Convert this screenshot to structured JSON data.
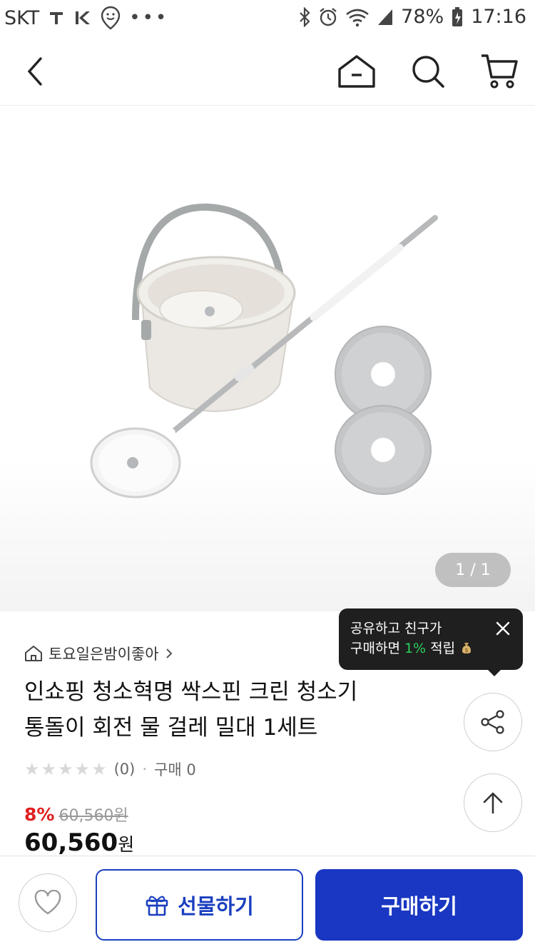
{
  "status_bar": {
    "carrier": "SKT",
    "battery": "78%",
    "time": "17:16"
  },
  "nav": {
    "back_icon": "chevron-left-icon",
    "home_icon": "home-icon",
    "search_icon": "search-icon",
    "cart_icon": "cart-icon"
  },
  "gallery": {
    "counter": "1 / 1"
  },
  "tooltip": {
    "line1": "공유하고 친구가",
    "line2_prefix": "구매하면 ",
    "line2_highlight": "1%",
    "line2_suffix": " 적립",
    "highlight_color": "#2ccd5b"
  },
  "product": {
    "store_name": "토요일은밤이좋아",
    "title_line1": "인쇼핑 청소혁명 싹스핀 크린 청소기",
    "title_line2": "통돌이 회전 물 걸레 밀대 1세트",
    "rating_count": "(0)",
    "purchase_count": "구매 0",
    "discount_rate": "8%",
    "original_price": "60,560원",
    "price_number": "60,560",
    "price_unit": "원"
  },
  "bottom_bar": {
    "gift_label": "선물하기",
    "buy_label": "구매하기",
    "accent_color": "#1937c2"
  }
}
